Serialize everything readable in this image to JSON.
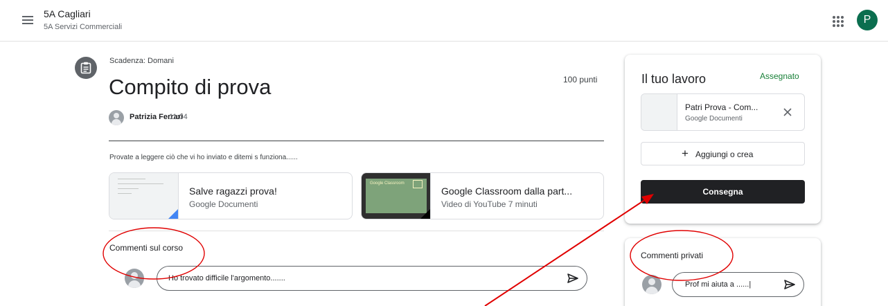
{
  "header": {
    "class_name": "5A Cagliari",
    "class_section": "5A Servizi Commerciali",
    "account_initial": "P"
  },
  "assignment": {
    "due": "Scadenza: Domani",
    "title": "Compito di prova",
    "points": "100 punti",
    "author": "Patrizia Ferrari",
    "time": "11:04",
    "description": "Provate a leggere ciò che vi ho inviato e ditemi s funziona......",
    "attachments": [
      {
        "title": "Salve ragazzi prova!",
        "subtitle": "Google Documenti"
      },
      {
        "title": "Google Classroom dalla part...",
        "subtitle": "Video di YouTube  7 minuti",
        "thumb_label": "Google Classroom"
      }
    ]
  },
  "course_comments": {
    "heading": "Commenti sul corso",
    "draft": "Ho trovato difficile l'argomento......."
  },
  "your_work": {
    "title": "Il tuo lavoro",
    "status": "Assegnato",
    "file": {
      "name": "Patri Prova - Com...",
      "type": "Google Documenti"
    },
    "add_label": "Aggiungi o crea",
    "submit_label": "Consegna"
  },
  "private_comments": {
    "heading": "Commenti privati",
    "draft": "Prof mi aiuta a ......|"
  },
  "colors": {
    "accent_green": "#188038",
    "avatar_green": "#0b6e4f",
    "submit_dark": "#202124",
    "annotation_red": "#ff0000"
  },
  "icons": [
    "menu-icon",
    "apps-icon",
    "assignment-icon",
    "send-icon",
    "close-icon",
    "plus-icon"
  ]
}
